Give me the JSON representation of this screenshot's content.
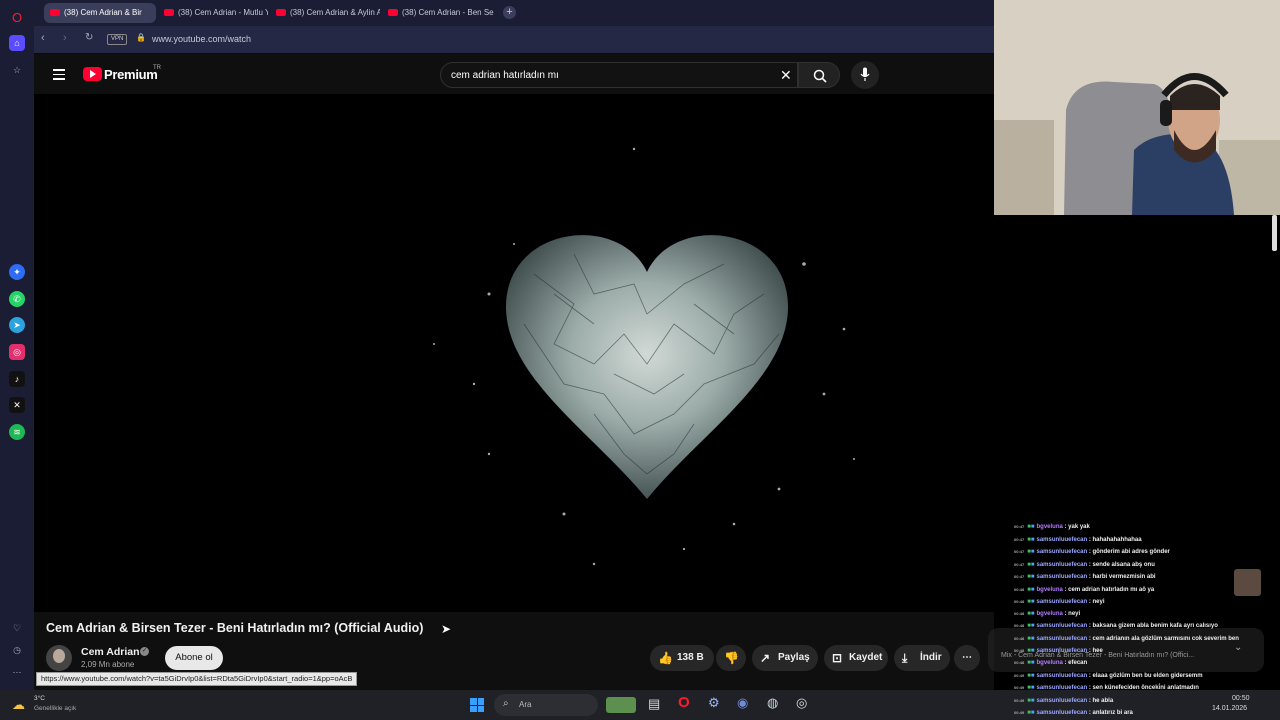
{
  "tabs": [
    {
      "label": "(38) Cem Adrian & Bir"
    },
    {
      "label": "(38) Cem Adrian - Mutlu Y"
    },
    {
      "label": "(38) Cem Adrian & Aylin A"
    },
    {
      "label": "(38) Cem Adrian - Ben Sen"
    }
  ],
  "address": {
    "vpn": "VPN",
    "url": "www.youtube.com/watch"
  },
  "youtube": {
    "logo": "Premium",
    "region": "TR",
    "search_value": "cem adrian hatırladın mı"
  },
  "video": {
    "title": "Cem Adrian & Birsen Tezer - Beni Hatırladın mı? (Official Audio)",
    "channel": "Cem Adrian",
    "subscribers": "2,09 Mn abone",
    "subscribe_label": "Abone ol",
    "likes": "138 B",
    "share": "Paylaş",
    "save": "Kaydet",
    "download": "İndir",
    "mix_text": "Mix - Cem Adrian & Birsen Tezer - Beni Hatırladın mı? (Offici..."
  },
  "status_url": "https://www.youtube.com/watch?v=ta5GiDrvIp0&list=RDta5GiDrvIp0&start_radio=1&pp=oAcB",
  "chat": [
    {
      "time": "00:47",
      "user": "bgveluna",
      "msg": "yak yak",
      "color": "#b57cff"
    },
    {
      "time": "00:47",
      "user": "samsunluuefecan",
      "msg": "hahahahahhahaa",
      "color": "#9aa7ff"
    },
    {
      "time": "00:47",
      "user": "samsunluuefecan",
      "msg": "gönderim abi adres gönder",
      "color": "#9aa7ff"
    },
    {
      "time": "00:47",
      "user": "samsunluuefecan",
      "msg": "sende alsana abş onu",
      "color": "#9aa7ff"
    },
    {
      "time": "00:47",
      "user": "samsunluuefecan",
      "msg": "harbi vermezmisin abi",
      "color": "#9aa7ff"
    },
    {
      "time": "00:48",
      "user": "bgveluna",
      "msg": "cem adrian hatırladın mı aö ya",
      "color": "#b57cff"
    },
    {
      "time": "00:48",
      "user": "samsunluuefecan",
      "msg": "neyi",
      "color": "#9aa7ff"
    },
    {
      "time": "00:48",
      "user": "bgveluna",
      "msg": "neyi",
      "color": "#b57cff"
    },
    {
      "time": "00:48",
      "user": "samsunluuefecan",
      "msg": "baksana gizem abla benim kafa ayrı calısıyo",
      "color": "#9aa7ff"
    },
    {
      "time": "00:48",
      "user": "samsunluuefecan",
      "msg": "cem adrianın ala gözlüm sarmısını cok severim ben",
      "color": "#9aa7ff"
    },
    {
      "time": "00:48",
      "user": "samsunluuefecan",
      "msg": "hee",
      "color": "#9aa7ff"
    },
    {
      "time": "00:48",
      "user": "bgveluna",
      "msg": "efecan",
      "color": "#b57cff"
    },
    {
      "time": "00:49",
      "user": "samsunluuefecan",
      "msg": "elaaa gözlüm ben bu elden gidersemm",
      "color": "#9aa7ff"
    },
    {
      "time": "00:49",
      "user": "samsunluuefecan",
      "msg": "sen künefeciden önceki̇ni anlatmadın",
      "color": "#9aa7ff"
    },
    {
      "time": "00:49",
      "user": "samsunluuefecan",
      "msg": "he abla",
      "color": "#9aa7ff"
    },
    {
      "time": "00:49",
      "user": "samsunluuefecan",
      "msg": "anlatırız bi ara",
      "color": "#9aa7ff"
    }
  ],
  "taskbar": {
    "weather_temp": "3°C",
    "weather_desc": "Genellikle açık",
    "search": "Ara",
    "time": "00:50",
    "date": "14.01.2026"
  },
  "colors": {
    "youtube_red": "#ff0033",
    "opera_red": "#ff1b2d",
    "sidebar": "#1a1d33"
  }
}
